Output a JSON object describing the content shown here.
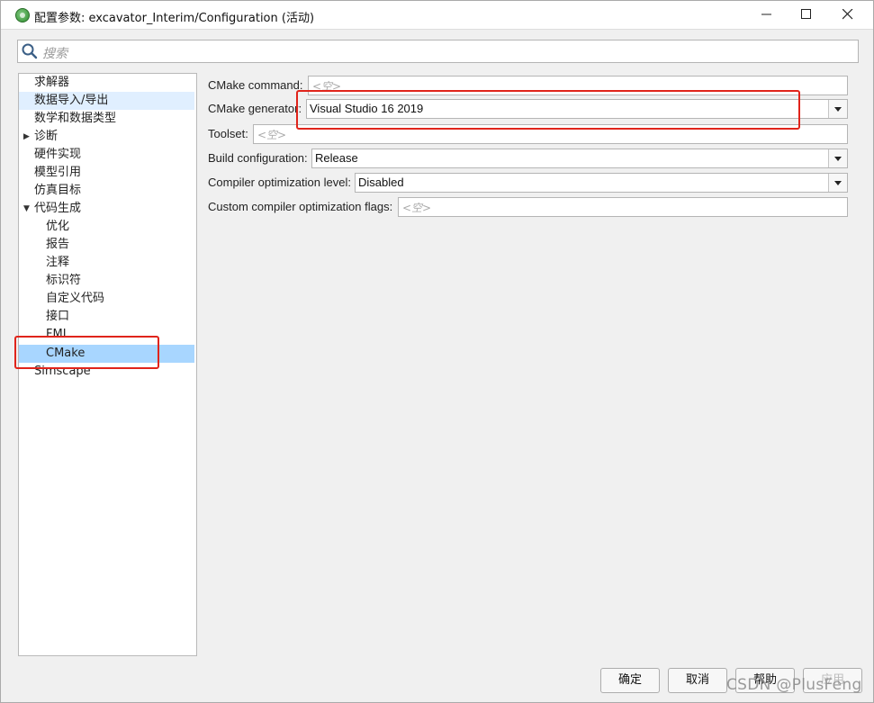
{
  "window": {
    "title": "配置参数: excavator_Interim/Configuration (活动)"
  },
  "search": {
    "placeholder": "搜索"
  },
  "tree": {
    "items": [
      {
        "label": "求解器"
      },
      {
        "label": "数据导入/导出"
      },
      {
        "label": "数学和数据类型"
      },
      {
        "label": "诊断"
      },
      {
        "label": "硬件实现"
      },
      {
        "label": "模型引用"
      },
      {
        "label": "仿真目标"
      },
      {
        "label": "代码生成"
      },
      {
        "label": "优化"
      },
      {
        "label": "报告"
      },
      {
        "label": "注释"
      },
      {
        "label": "标识符"
      },
      {
        "label": "自定义代码"
      },
      {
        "label": "接口"
      },
      {
        "label": "FMI"
      },
      {
        "label": "CMake"
      },
      {
        "label": "Simscape"
      }
    ]
  },
  "settings": {
    "cmake_command": {
      "label": "CMake command:",
      "placeholder": "<空>"
    },
    "cmake_generator": {
      "label": "CMake generator:",
      "value": "Visual Studio 16 2019"
    },
    "toolset": {
      "label": "Toolset:",
      "placeholder": "<空>"
    },
    "build_configuration": {
      "label": "Build configuration:",
      "value": "Release"
    },
    "compiler_optimization_level": {
      "label": "Compiler optimization level:",
      "value": "Disabled"
    },
    "custom_compiler_flags": {
      "label": "Custom compiler optimization flags:",
      "placeholder": "<空>"
    }
  },
  "buttons": {
    "ok": "确定",
    "cancel": "取消",
    "help": "帮助",
    "apply": "应用"
  },
  "watermark": "CSDN @PlusFeng",
  "colors": {
    "selection": "#a8d6ff",
    "highlight": "#e0efff",
    "annotation_red": "#e0241b"
  }
}
